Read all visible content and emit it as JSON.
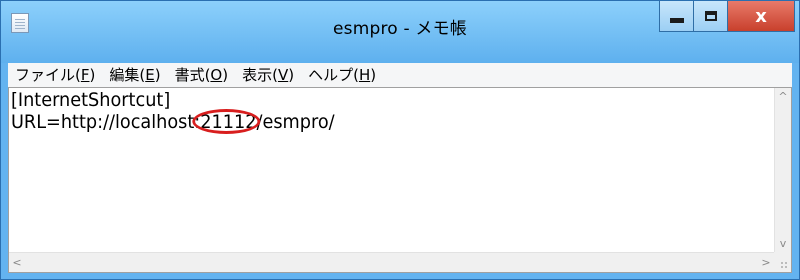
{
  "window": {
    "title": "esmpro - メモ帳",
    "close_label": "x"
  },
  "menu": {
    "items": [
      {
        "label": "ファイル(",
        "key": "F",
        "end": ")"
      },
      {
        "label": "編集(",
        "key": "E",
        "end": ")"
      },
      {
        "label": "書式(",
        "key": "O",
        "end": ")"
      },
      {
        "label": "表示(",
        "key": "V",
        "end": ")"
      },
      {
        "label": "ヘルプ(",
        "key": "H",
        "end": ")"
      }
    ]
  },
  "document": {
    "line1": "[InternetShortcut]",
    "line2_prefix": "URL=http://localhost:",
    "line2_port": "21112",
    "line2_suffix": "/esmpro/"
  },
  "scrollbars": {
    "up_arrow": "^",
    "down_arrow": "v",
    "left_arrow": "<",
    "right_arrow": ">"
  },
  "colors": {
    "titlebar": "#63b3f0",
    "close_button": "#c8402c",
    "highlight_circle": "#d81e1e"
  }
}
